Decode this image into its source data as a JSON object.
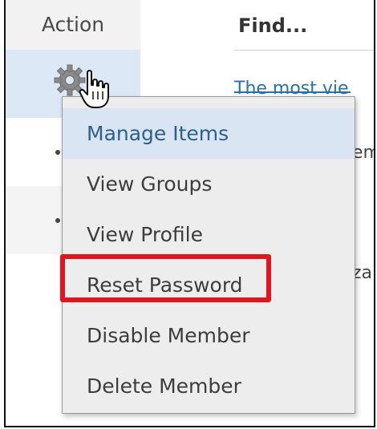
{
  "table": {
    "action_header": "Action",
    "find_header": "Find..."
  },
  "background": {
    "line1": "The most vie",
    "line2": "em",
    "line3": "za"
  },
  "menu": {
    "items": [
      {
        "label": "Manage Items",
        "state": "hovered"
      },
      {
        "label": "View Groups"
      },
      {
        "label": "View Profile"
      },
      {
        "label": "Reset Password",
        "highlighted": true
      },
      {
        "label": "Disable Member"
      },
      {
        "label": "Delete Member"
      }
    ]
  },
  "icons": {
    "gear": "gear-icon",
    "cursor": "hand-pointer-cursor"
  },
  "colors": {
    "highlight_border": "#e3141b",
    "hover_row": "#dde8f6",
    "link": "#2a6fb0"
  }
}
